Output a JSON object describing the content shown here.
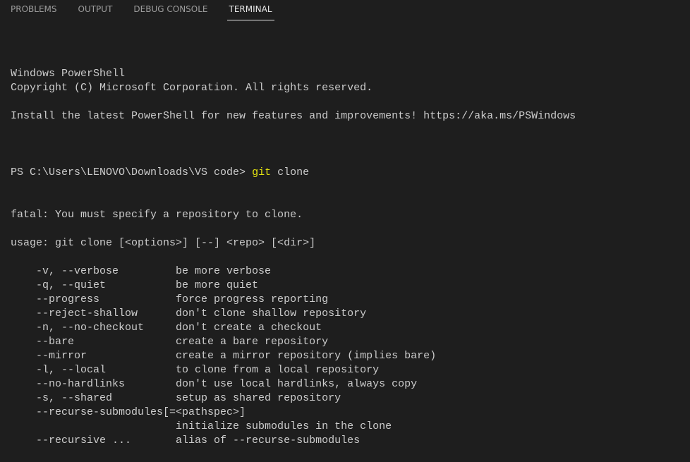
{
  "tabs": [
    {
      "label": "PROBLEMS",
      "active": false
    },
    {
      "label": "OUTPUT",
      "active": false
    },
    {
      "label": "DEBUG CONSOLE",
      "active": false
    },
    {
      "label": "TERMINAL",
      "active": true
    }
  ],
  "terminal": {
    "banner": [
      "Windows PowerShell",
      "Copyright (C) Microsoft Corporation. All rights reserved.",
      "",
      "Install the latest PowerShell for new features and improvements! https://aka.ms/PSWindows",
      ""
    ],
    "prompt": "PS C:\\Users\\LENOVO\\Downloads\\VS code> ",
    "command": "git",
    "command_args": " clone",
    "output": [
      "fatal: You must specify a repository to clone.",
      "",
      "usage: git clone [<options>] [--] <repo> [<dir>]",
      "",
      "    -v, --verbose         be more verbose",
      "    -q, --quiet           be more quiet",
      "    --progress            force progress reporting",
      "    --reject-shallow      don't clone shallow repository",
      "    -n, --no-checkout     don't create a checkout",
      "    --bare                create a bare repository",
      "    --mirror              create a mirror repository (implies bare)",
      "    -l, --local           to clone from a local repository",
      "    --no-hardlinks        don't use local hardlinks, always copy",
      "    -s, --shared          setup as shared repository",
      "    --recurse-submodules[=<pathspec>]",
      "                          initialize submodules in the clone",
      "    --recursive ...       alias of --recurse-submodules"
    ]
  },
  "colors": {
    "background": "#1e1e1e",
    "text": "#cccccc",
    "command": "#e5e510"
  }
}
